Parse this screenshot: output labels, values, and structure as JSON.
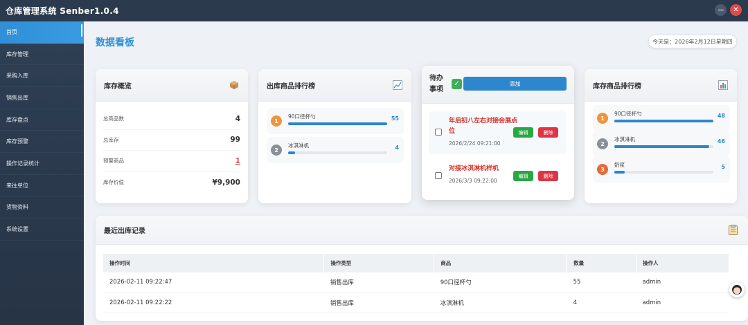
{
  "window": {
    "title": "仓库管理系统 Senber1.0.4"
  },
  "sidebar": {
    "items": [
      {
        "label": "首页",
        "active": true
      },
      {
        "label": "库存管理"
      },
      {
        "label": "采购入库"
      },
      {
        "label": "销售出库"
      },
      {
        "label": "库存盘点"
      },
      {
        "label": "库存预警"
      },
      {
        "label": "操作记录统计"
      },
      {
        "label": "来往单位"
      },
      {
        "label": "货物资料"
      },
      {
        "label": "系统设置"
      }
    ]
  },
  "header": {
    "title": "数据看板",
    "today": "今天是：2026年2月12日星期四"
  },
  "overview": {
    "title": "库存概览",
    "icon": "package-icon",
    "rows": [
      {
        "label": "总商品数",
        "value": "4"
      },
      {
        "label": "总库存",
        "value": "99"
      },
      {
        "label": "预警商品",
        "value": "1"
      },
      {
        "label": "库存价值",
        "value": "¥9,900"
      }
    ]
  },
  "outbound_rank": {
    "title": "出库商品排行榜",
    "icon": "trend-chart-icon",
    "items": [
      {
        "rank": "1",
        "name": "90口径杯勺",
        "value": "55",
        "fraction": 1.0
      },
      {
        "rank": "2",
        "name": "冰淇淋机",
        "value": "4",
        "fraction": 0.073
      }
    ]
  },
  "todo": {
    "title": "待办事项",
    "add_label": "添加",
    "edit_label": "编辑",
    "delete_label": "删除",
    "items": [
      {
        "text": "年后初八左右对接会展点位",
        "date": "2026/2/24 09:21:00"
      },
      {
        "text": "对接冰淇淋机样机",
        "date": "2026/3/3 09:22:00"
      }
    ]
  },
  "stock_rank": {
    "title": "库存商品排行榜",
    "icon": "bar-chart-icon",
    "items": [
      {
        "rank": "1",
        "name": "90口径杯勺",
        "value": "48",
        "fraction": 1.0
      },
      {
        "rank": "2",
        "name": "冰淇淋机",
        "value": "46",
        "fraction": 0.958
      },
      {
        "rank": "3",
        "name": "奶浆",
        "value": "5",
        "fraction": 0.104
      }
    ]
  },
  "records": {
    "title": "最近出库记录",
    "icon": "clipboard-icon",
    "columns": [
      "操作时间",
      "操作类型",
      "商品",
      "数量",
      "操作人"
    ],
    "rows": [
      [
        "2026-02-11 09:22:47",
        "销售出库",
        "90口径杯勺",
        "55",
        "admin"
      ],
      [
        "2026-02-11 09:22:22",
        "销售出库",
        "冰淇淋机",
        "4",
        "admin"
      ]
    ]
  },
  "colors": {
    "accent": "#2e86cc",
    "sidebar": "#2f3f54",
    "danger": "#dc3545",
    "success": "#28a745"
  }
}
